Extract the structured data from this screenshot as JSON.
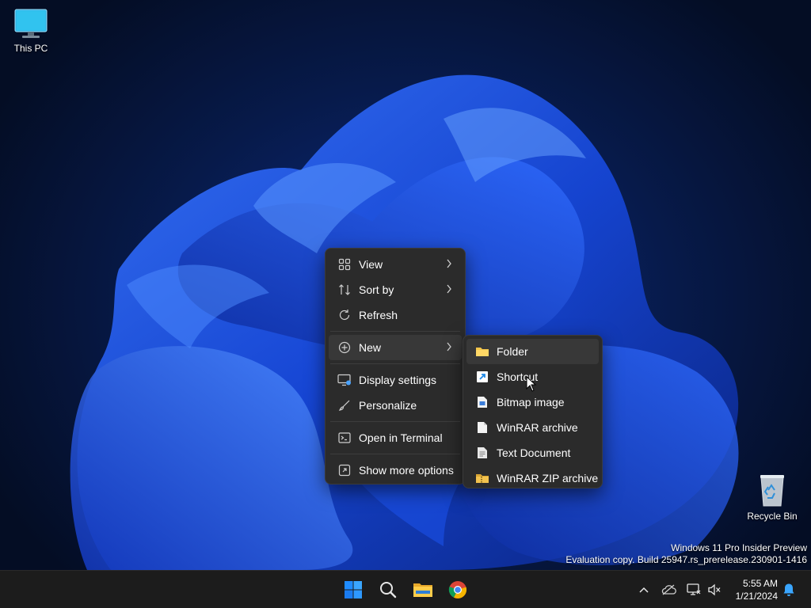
{
  "desktop": {
    "icons": [
      {
        "label": "This PC"
      },
      {
        "label": "Recycle Bin"
      }
    ],
    "watermark": {
      "line1": "Windows 11 Pro Insider Preview",
      "line2": "Evaluation copy. Build 25947.rs_prerelease.230901-1416"
    }
  },
  "context_menu": {
    "items": [
      {
        "label": "View",
        "icon": "grid-icon",
        "has_submenu": true
      },
      {
        "label": "Sort by",
        "icon": "sort-icon",
        "has_submenu": true
      },
      {
        "label": "Refresh",
        "icon": "refresh-icon",
        "has_submenu": false
      },
      {
        "label": "New",
        "icon": "plus-circle-icon",
        "has_submenu": true
      },
      {
        "label": "Display settings",
        "icon": "display-icon",
        "has_submenu": false
      },
      {
        "label": "Personalize",
        "icon": "brush-icon",
        "has_submenu": false
      },
      {
        "label": "Open in Terminal",
        "icon": "terminal-icon",
        "has_submenu": false
      },
      {
        "label": "Show more options",
        "icon": "more-options-icon",
        "has_submenu": false
      }
    ],
    "new_submenu": {
      "items": [
        {
          "label": "Folder",
          "icon": "folder-icon"
        },
        {
          "label": "Shortcut",
          "icon": "shortcut-icon"
        },
        {
          "label": "Bitmap image",
          "icon": "bitmap-icon"
        },
        {
          "label": "WinRAR archive",
          "icon": "winrar-archive-icon"
        },
        {
          "label": "Text Document",
          "icon": "text-document-icon"
        },
        {
          "label": "WinRAR ZIP archive",
          "icon": "winrar-zip-icon"
        }
      ]
    }
  },
  "taskbar": {
    "pinned": [
      "start-icon",
      "search-icon",
      "file-explorer-icon",
      "chrome-icon"
    ],
    "tray": [
      "chevron-up-icon",
      "onedrive-icon",
      "network-icon",
      "volume-muted-icon"
    ],
    "clock": {
      "time": "5:55 AM",
      "date": "1/21/2024"
    },
    "notification": "bell-icon"
  },
  "colors": {
    "menu_bg": "#2b2b2b",
    "accent": "#0078d4",
    "taskbar_bg": "#1c1c1c"
  }
}
